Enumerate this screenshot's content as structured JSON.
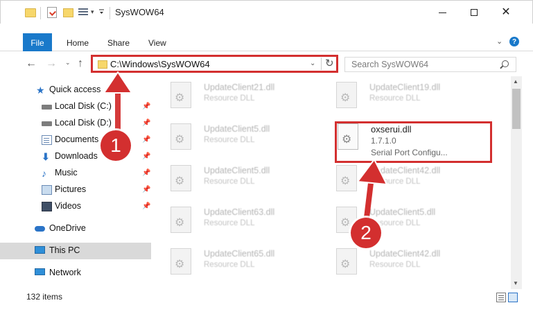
{
  "window": {
    "title": "SysWOW64",
    "minimize_icon": "minimize-icon",
    "maximize_icon": "maximize-icon",
    "close_glyph": "✕"
  },
  "quick_access_toolbar": {
    "dropdown_glyph": "▾",
    "icons": [
      "folder-icon",
      "properties-icon",
      "new-folder-icon",
      "view-icon"
    ]
  },
  "ribbon": {
    "tabs": [
      {
        "label": "File",
        "active": true
      },
      {
        "label": "Home"
      },
      {
        "label": "Share"
      },
      {
        "label": "View"
      }
    ],
    "expand_glyph": "⌄",
    "help_glyph": "?",
    "accent_color": "#1979ca"
  },
  "nav": {
    "back_glyph": "←",
    "forward_glyph": "→",
    "recent_glyph": "⌄",
    "up_glyph": "↑",
    "address": "C:\\Windows\\SysWOW64",
    "address_dropdown": "⌄",
    "refresh_glyph": "↻",
    "search_placeholder": "Search SysWOW64"
  },
  "sidebar": {
    "items": [
      {
        "label": "Quick access",
        "icon": "star-icon",
        "pinned": false
      },
      {
        "label": "Local Disk (C:)",
        "icon": "disk-icon",
        "pinned": true
      },
      {
        "label": "Local Disk (D:)",
        "icon": "disk-icon",
        "pinned": true
      },
      {
        "label": "Documents",
        "icon": "documents-icon",
        "pinned": true
      },
      {
        "label": "Downloads",
        "icon": "downloads-icon",
        "pinned": true
      },
      {
        "label": "Music",
        "icon": "music-icon",
        "pinned": true
      },
      {
        "label": "Pictures",
        "icon": "pictures-icon",
        "pinned": true
      },
      {
        "label": "Videos",
        "icon": "videos-icon",
        "pinned": true
      },
      {
        "label": "OneDrive",
        "icon": "onedrive-icon",
        "pinned": false
      },
      {
        "label": "This PC",
        "icon": "this-pc-icon",
        "pinned": false,
        "selected": true
      },
      {
        "label": "Network",
        "icon": "network-icon",
        "pinned": false
      }
    ],
    "pin_glyph": "📌"
  },
  "files": {
    "left_column": [
      {
        "name": "UpdateClient21.dll",
        "description": "Resource DLL"
      },
      {
        "name": "UpdateClient5.dll",
        "description": "Resource DLL"
      },
      {
        "name": "UpdateClient5.dll",
        "description": "Resource DLL"
      },
      {
        "name": "UpdateClient63.dll",
        "description": "Resource DLL"
      },
      {
        "name": "UpdateClient65.dll",
        "description": "Resource DLL"
      }
    ],
    "right_column": [
      {
        "name": "UpdateClient19.dll",
        "description": "Resource DLL"
      },
      {
        "name": "oxserui.dll",
        "version": "1.7.1.0",
        "description": "Serial Port Configu...",
        "focused": true
      },
      {
        "name": "UpdateClient42.dll",
        "description": "Resource DLL"
      },
      {
        "name": "UpdateClient5.dll",
        "description": "Resource DLL"
      },
      {
        "name": "UpdateClient42.dll",
        "description": "Resource DLL"
      }
    ]
  },
  "scrollbar": {
    "up_glyph": "▲",
    "down_glyph": "▼"
  },
  "status": {
    "item_count": "132 items"
  },
  "annotations": {
    "step_1": "1",
    "step_2": "2",
    "highlight_color": "#d32f2f"
  }
}
